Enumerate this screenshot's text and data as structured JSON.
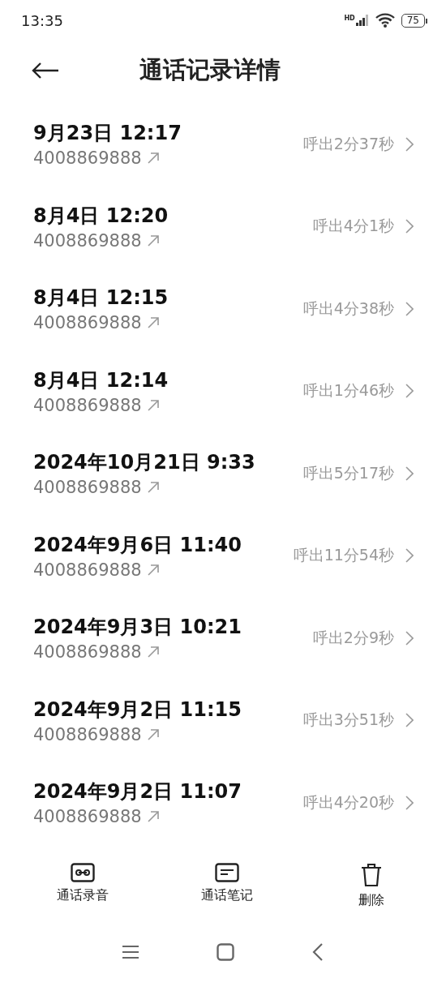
{
  "status_bar": {
    "time": "13:35",
    "network": "HD",
    "battery": "75"
  },
  "header": {
    "title": "通话记录详情"
  },
  "calls": [
    {
      "date": "9月23日 12:17",
      "number": "4008869888",
      "duration": "呼出2分37秒"
    },
    {
      "date": "8月4日 12:20",
      "number": "4008869888",
      "duration": "呼出4分1秒"
    },
    {
      "date": "8月4日 12:15",
      "number": "4008869888",
      "duration": "呼出4分38秒"
    },
    {
      "date": "8月4日 12:14",
      "number": "4008869888",
      "duration": "呼出1分46秒"
    },
    {
      "date": "2024年10月21日 9:33",
      "number": "4008869888",
      "duration": "呼出5分17秒"
    },
    {
      "date": "2024年9月6日 11:40",
      "number": "4008869888",
      "duration": "呼出11分54秒"
    },
    {
      "date": "2024年9月3日 10:21",
      "number": "4008869888",
      "duration": "呼出2分9秒"
    },
    {
      "date": "2024年9月2日 11:15",
      "number": "4008869888",
      "duration": "呼出3分51秒"
    },
    {
      "date": "2024年9月2日 11:07",
      "number": "4008869888",
      "duration": "呼出4分20秒"
    }
  ],
  "actions": [
    {
      "kind": "recording",
      "label": "通话录音"
    },
    {
      "kind": "note",
      "label": "通话笔记"
    },
    {
      "kind": "delete",
      "label": "删除"
    }
  ]
}
